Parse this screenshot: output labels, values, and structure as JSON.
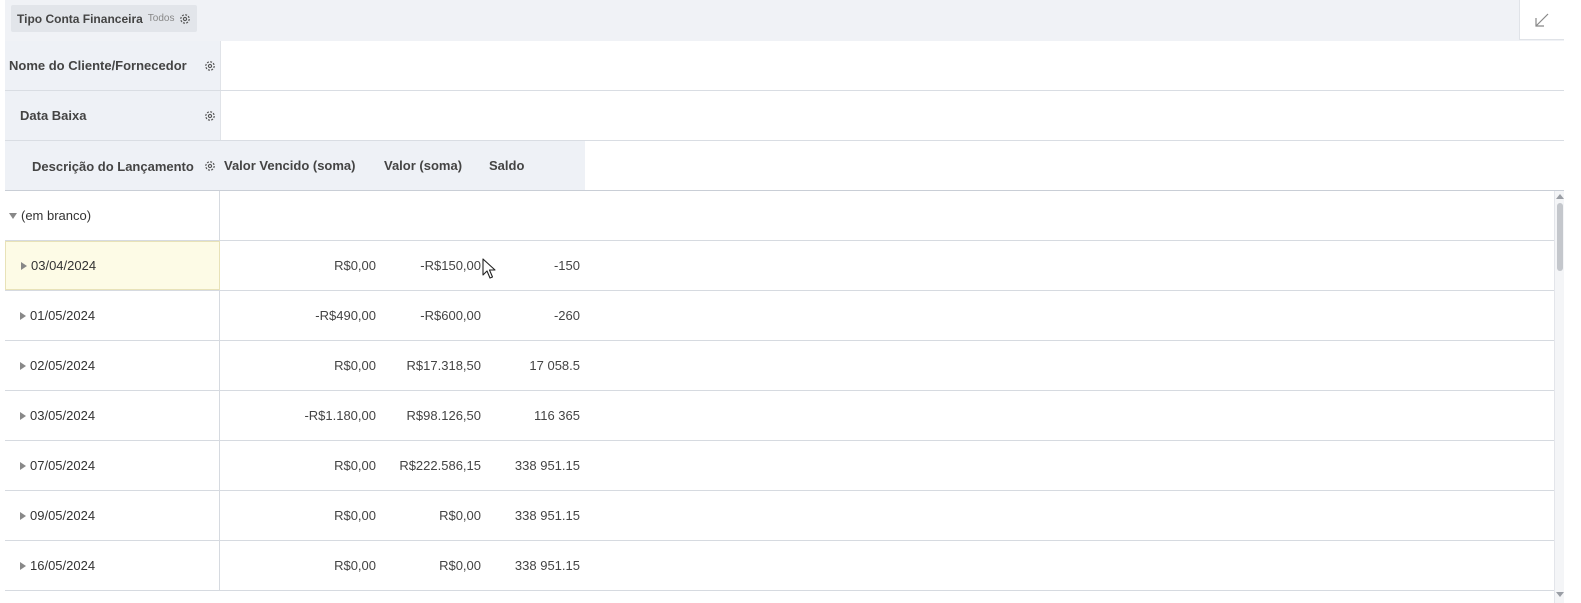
{
  "filter": {
    "label": "Tipo Conta Financeira",
    "value": "Todos",
    "icon": "gear-icon"
  },
  "corner_icon": "collapse-arrow-icon",
  "axes": {
    "row1": {
      "label": "Nome do Cliente/Fornecedor"
    },
    "row2": {
      "label": "Data Baixa"
    },
    "row3": {
      "label": "Descrição do Lançamento"
    }
  },
  "columns": [
    "Valor Vencido (soma)",
    "Valor (soma)",
    "Saldo"
  ],
  "group": {
    "label": "(em branco)",
    "expanded": true
  },
  "rows": [
    {
      "date": "03/04/2024",
      "vencido": "R$0,00",
      "valor": "-R$150,00",
      "saldo": "-150",
      "selected": true
    },
    {
      "date": "01/05/2024",
      "vencido": "-R$490,00",
      "valor": "-R$600,00",
      "saldo": "-260"
    },
    {
      "date": "02/05/2024",
      "vencido": "R$0,00",
      "valor": "R$17.318,50",
      "saldo": "17 058.5"
    },
    {
      "date": "03/05/2024",
      "vencido": "-R$1.180,00",
      "valor": "R$98.126,50",
      "saldo": "116 365"
    },
    {
      "date": "07/05/2024",
      "vencido": "R$0,00",
      "valor": "R$222.586,15",
      "saldo": "338 951.15"
    },
    {
      "date": "09/05/2024",
      "vencido": "R$0,00",
      "valor": "R$0,00",
      "saldo": "338 951.15"
    },
    {
      "date": "16/05/2024",
      "vencido": "R$0,00",
      "valor": "R$0,00",
      "saldo": "338 951.15"
    }
  ]
}
